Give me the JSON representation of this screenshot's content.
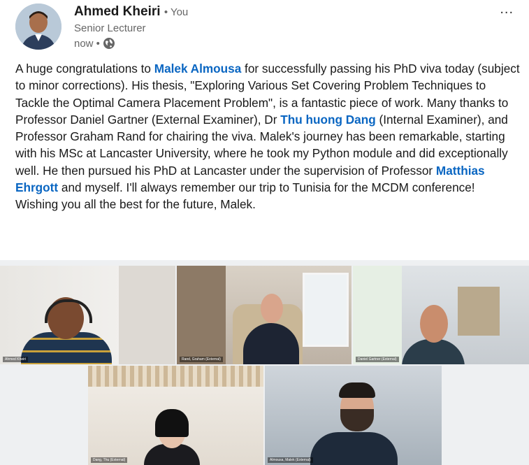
{
  "author": {
    "name": "Ahmed Kheiri",
    "you_marker": "• You",
    "title": "Senior Lecturer",
    "time": "now •",
    "visibility_icon": "globe-icon",
    "more_icon": "more-dots-icon",
    "more_label": "..."
  },
  "post": {
    "t1": "A huge congratulations to ",
    "m1": "Malek Almousa",
    "t2": " for successfully passing his PhD viva today (subject to minor corrections). His thesis, \"Exploring Various Set Covering Problem Techniques to Tackle the Optimal Camera Placement Problem\", is a fantastic piece of work. Many thanks to Professor Daniel Gartner (External Examiner), Dr ",
    "m2": "Thu huong Dang",
    "t3": " (Internal Examiner), and Professor Graham Rand for chairing the viva. Malek's journey has been remarkable, starting with his MSc at Lancaster University, where he took my Python module and did exceptionally well. He then pursued his PhD at Lancaster under the supervision of Professor ",
    "m3": "Matthias Ehrgott",
    "t4": " and myself. I'll always remember our trip to Tunisia for the MCDM conference! Wishing you all the best for the future, Malek."
  },
  "video_call": {
    "tiles": [
      {
        "label": "Ahmed Kheiri"
      },
      {
        "label": "Rand, Graham (External)"
      },
      {
        "label": "Daniel Gartner (External)"
      },
      {
        "label": "Dang, Thu (External)"
      },
      {
        "label": "Almousa, Malek (External)"
      }
    ]
  },
  "colors": {
    "link": "#0a66c2",
    "text": "#191919",
    "muted": "#666666"
  }
}
